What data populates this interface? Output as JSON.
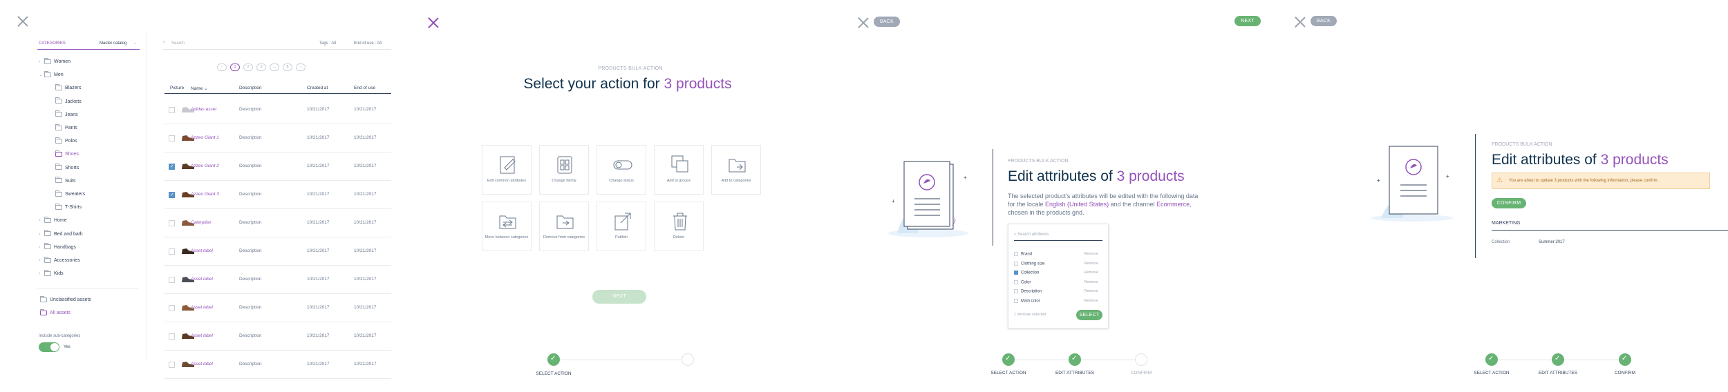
{
  "screen1": {
    "sidebar": {
      "categories_label": "CATEGORIES",
      "catalog_selector": "Master catalog",
      "tree": [
        {
          "label": "Women",
          "level": 0,
          "chev": "›"
        },
        {
          "label": "Men",
          "level": 0,
          "chev": "⌄"
        },
        {
          "label": "Blazers",
          "level": 1
        },
        {
          "label": "Jackets",
          "level": 1
        },
        {
          "label": "Jeans",
          "level": 1
        },
        {
          "label": "Pants",
          "level": 1
        },
        {
          "label": "Polos",
          "level": 1
        },
        {
          "label": "Shoes",
          "level": 1,
          "active": true
        },
        {
          "label": "Shorts",
          "level": 1
        },
        {
          "label": "Suits",
          "level": 1
        },
        {
          "label": "Sweaters",
          "level": 1
        },
        {
          "label": "T-Shirts",
          "level": 1
        },
        {
          "label": "Home",
          "level": 0,
          "chev": "›"
        },
        {
          "label": "Bed and bath",
          "level": 0,
          "chev": "›"
        },
        {
          "label": "Handbags",
          "level": 0,
          "chev": "›"
        },
        {
          "label": "Accessories",
          "level": 0,
          "chev": "›"
        },
        {
          "label": "Kids",
          "level": 0,
          "chev": "›"
        }
      ],
      "unclassified": "Unclassified assets",
      "all_assets": "All assets",
      "include_sub": "Include sub-categories",
      "toggle_value": "Yes"
    },
    "toolbar": {
      "search_placeholder": "Search",
      "tags_filter": "Tags : All",
      "eol_filter": "End of use : All"
    },
    "pagination": [
      "‹",
      "1",
      "2",
      "3",
      "...",
      "8",
      "›"
    ],
    "columns": [
      "Picture",
      "Name ⌄",
      "Description",
      "Created at",
      "End of use"
    ],
    "rows": [
      {
        "name": "Adidas asset",
        "desc": "Description",
        "created": "10/21/2017",
        "eol": "10/21/2017",
        "checked": false
      },
      {
        "name": "Azzeo Giant 1",
        "desc": "Description",
        "created": "10/21/2017",
        "eol": "10/21/2017",
        "checked": false
      },
      {
        "name": "Azzeo Giant 2",
        "desc": "Description",
        "created": "10/21/2017",
        "eol": "10/21/2017",
        "checked": true
      },
      {
        "name": "Azzeo Giant 3",
        "desc": "Description",
        "created": "10/21/2017",
        "eol": "10/21/2017",
        "checked": true
      },
      {
        "name": "Caterpillar",
        "desc": "Description",
        "created": "10/21/2017",
        "eol": "10/21/2017",
        "checked": false
      },
      {
        "name": "Asset label",
        "desc": "Description",
        "created": "10/21/2017",
        "eol": "10/21/2017",
        "checked": false
      },
      {
        "name": "Asset label",
        "desc": "Description",
        "created": "10/21/2017",
        "eol": "10/21/2017",
        "checked": false
      },
      {
        "name": "Asset label",
        "desc": "Description",
        "created": "10/21/2017",
        "eol": "10/21/2017",
        "checked": false
      },
      {
        "name": "Asset label",
        "desc": "Description",
        "created": "10/21/2017",
        "eol": "10/21/2017",
        "checked": false
      },
      {
        "name": "Asset label",
        "desc": "Description",
        "created": "10/21/2017",
        "eol": "10/21/2017",
        "checked": false
      }
    ]
  },
  "screen2": {
    "kicker": "PRODUCTS BULK ACTION",
    "title_prefix": "Select your action for ",
    "title_highlight": "3 products",
    "actions": [
      "Edit common attributes",
      "Change family",
      "Change status",
      "Add to groups",
      "Add to categories",
      "Move between categories",
      "Remove from categories",
      "Publish",
      "Delete"
    ],
    "next_label": "NEXT",
    "steps": [
      {
        "label": "SELECT ACTION",
        "state": "done"
      }
    ]
  },
  "screen3": {
    "back_label": "BACK",
    "next_label": "NEXT",
    "kicker": "PRODUCTS BULK ACTION",
    "title_prefix": "Edit attributes of ",
    "title_highlight": "3 products",
    "desc_1": "The selected product's attributes will be edited with the following data",
    "desc_2": "for the locale ",
    "locale": "English (United States)",
    "desc_3": " and the channel ",
    "channel": "Ecommerce",
    "desc_4": ",",
    "desc_5": "chosen in the products grid.",
    "search_placeholder": "Search attributes",
    "attributes": [
      {
        "label": "Brand",
        "remove": "Remove",
        "checked": false
      },
      {
        "label": "Clothing size",
        "remove": "Remove",
        "checked": false
      },
      {
        "label": "Collection",
        "remove": "Remove",
        "checked": true
      },
      {
        "label": "Color",
        "remove": "Remove",
        "checked": false
      },
      {
        "label": "Description",
        "remove": "Remove",
        "checked": false
      },
      {
        "label": "Main color",
        "remove": "Remove",
        "checked": false
      }
    ],
    "selected_count": "1 attribute selected",
    "select_label": "SELECT",
    "steps": [
      {
        "label": "SELECT ACTION",
        "state": "done"
      },
      {
        "label": "EDIT ATTRIBUTES",
        "state": "done"
      },
      {
        "label": "CONFIRM",
        "state": "todo"
      }
    ]
  },
  "screen4": {
    "back_label": "BACK",
    "kicker": "PRODUCTS BULK ACTION",
    "title_prefix": "Edit attributes of ",
    "title_highlight": "3 products",
    "warning": "You are about to update 3 products with the following information, please confirm.",
    "confirm_label": "CONFIRM",
    "section": "MARKETING",
    "field_label": "Collection",
    "field_value": "Summer 2017",
    "steps": [
      {
        "label": "SELECT ACTION",
        "state": "done"
      },
      {
        "label": "EDIT ATTRIBUTES",
        "state": "done"
      },
      {
        "label": "CONFIRM",
        "state": "done"
      }
    ]
  },
  "colors": {
    "accent": "#9452ba",
    "success": "#67b373",
    "warning_bg": "#fdecd2",
    "checkbox": "#5992c7"
  }
}
